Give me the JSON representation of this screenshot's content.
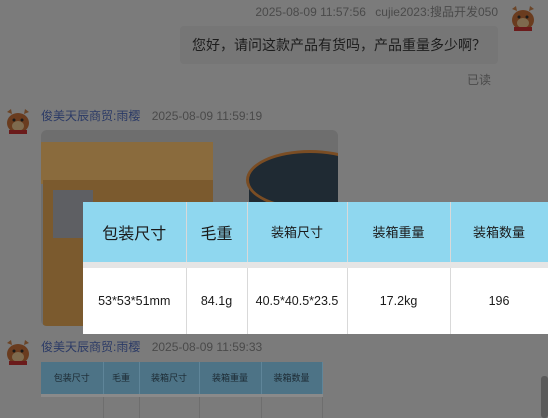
{
  "messages": [
    {
      "timestamp": "2025-08-09 11:57:56",
      "sender": "cujie2023:搜品开发050",
      "text": "您好，请问这款产品有货吗，产品重量多少啊？",
      "status": "已读"
    },
    {
      "sender": "俊美天辰商贸:雨樱",
      "timestamp": "2025-08-09 11:59:19"
    },
    {
      "sender": "俊美天辰商贸:雨樱",
      "timestamp": "2025-08-09 11:59:33"
    }
  ],
  "spec_table": {
    "headers": [
      "包装尺寸",
      "毛重",
      "装箱尺寸",
      "装箱重量",
      "装箱数量"
    ],
    "row": [
      "53*53*51mm",
      "84.1g",
      "40.5*40.5*23.5",
      "17.2kg",
      "196"
    ]
  },
  "mini_table": {
    "headers": [
      "包装尺寸",
      "毛重",
      "装箱尺寸",
      "装箱重量",
      "装箱数量"
    ]
  },
  "colors": {
    "table_header": "#8fd7ef",
    "overlay": "#7b7b7b"
  }
}
